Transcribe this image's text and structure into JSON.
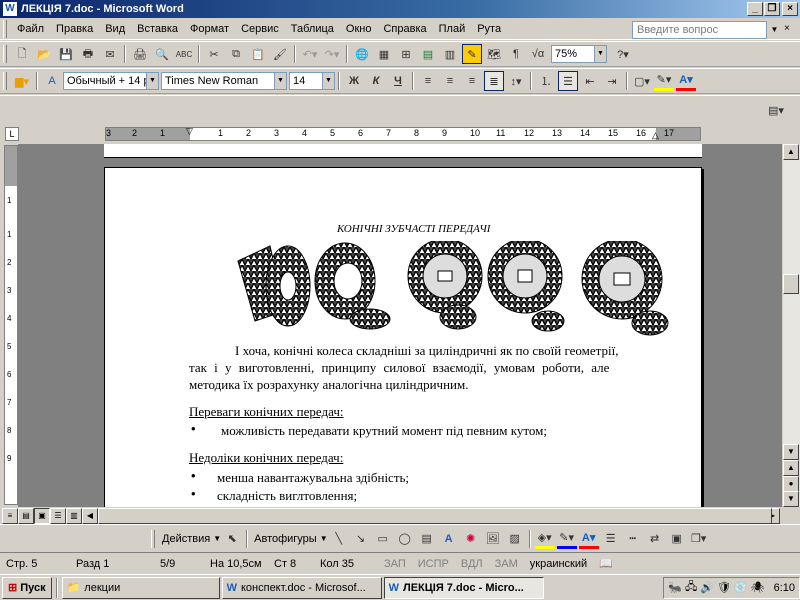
{
  "window": {
    "title": "ЛЕКЦІЯ 7.doc - Microsoft Word",
    "icon": "word-doc-icon"
  },
  "menu": {
    "items": [
      "Файл",
      "Правка",
      "Вид",
      "Вставка",
      "Формат",
      "Сервис",
      "Таблица",
      "Окно",
      "Справка",
      "Плай",
      "Рута"
    ],
    "help_placeholder": "Введите вопрос"
  },
  "toolbar_standard": {
    "zoom": "75%"
  },
  "toolbar_format": {
    "style": "Обычный + 14 р",
    "font": "Times New Roman",
    "size": "14",
    "bold": "Ж",
    "italic": "К",
    "underline": "Ч"
  },
  "ruler": {
    "labels": [
      "3",
      "2",
      "1",
      "1",
      "2",
      "3",
      "4",
      "5",
      "6",
      "7",
      "8",
      "9",
      "10",
      "11",
      "12",
      "13",
      "14",
      "15",
      "16",
      "17"
    ]
  },
  "vruler": {
    "labels": [
      "1",
      "1",
      "2",
      "3",
      "4",
      "5",
      "6",
      "7",
      "8",
      "9"
    ]
  },
  "document": {
    "heading": "КОНІЧНІ ЗУБЧАСТІ ПЕРЕДАЧІ",
    "para_line1": "І хоча, конічні колеса складніші за циліндричні як по своїй геометрії,",
    "para_line2": "так і у виготовленні, принципу силової взаємодії, умовам роботи, але",
    "para_line3": "методика їх розрахунку аналогічна циліндричним.",
    "advantages_title": "Переваги конічних передач:",
    "advantage_1": "можливість передавати крутний момент під певним кутом;",
    "disadvantages_title": "Недоліки конічних передач:",
    "disadvantage_1": "менша навантажувальна здібність;",
    "disadvantage_2": "складність виглтовлення;"
  },
  "drawing_toolbar": {
    "actions": "Действия",
    "autoshapes": "Автофигуры"
  },
  "status": {
    "page": "Стр. 5",
    "section": "Разд 1",
    "pages": "5/9",
    "at": "На 10,5см",
    "line": "Ст 8",
    "col": "Кол 35",
    "rec": "ЗАП",
    "trk": "ИСПР",
    "ext": "ВДЛ",
    "ovr": "ЗАМ",
    "lang": "украинский"
  },
  "taskbar": {
    "start": "Пуск",
    "tasks": [
      "лекции",
      "конспект.doc - Microsof...",
      "ЛЕКЦІЯ 7.doc - Micro..."
    ],
    "clock": "6:10"
  },
  "colors": {
    "title_start": "#0a246a",
    "title_end": "#a6caf0",
    "highlight": "#ffff00",
    "font_color": "#ff0000"
  }
}
